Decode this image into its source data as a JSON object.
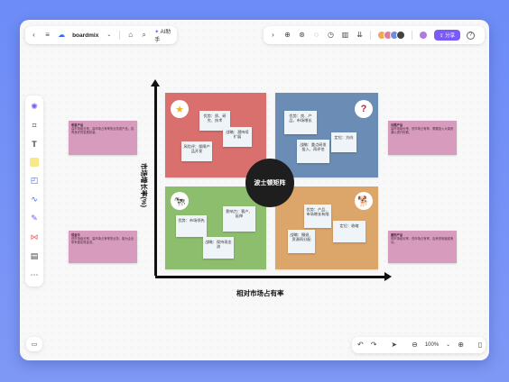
{
  "toolbar": {
    "back_icon": "chevron-left-icon",
    "menu_icon": "hamburger-icon",
    "brand": "boardmix",
    "tag_icon": "tag-icon",
    "search_icon": "search-icon",
    "ai_label": "AI助手"
  },
  "top_right": {
    "share_label": "分享",
    "help_icon": "question-icon"
  },
  "chart": {
    "center_label": "波士顿矩阵",
    "x_axis_label": "相对市场占有率",
    "y_axis_label": "市场增长率(%)"
  },
  "quadrants": {
    "star": {
      "color": "#d9706d",
      "stickies": [
        "优势：质、研究、技术",
        "风险评：保障产品开发",
        "战略：潜持续扩展"
      ]
    },
    "question": {
      "color": "#6b8db5",
      "stickies": [
        "优势：良、产品、市场增长",
        "战略：重点研发投入、再评估",
        "定位：方向"
      ]
    },
    "cow": {
      "color": "#8dbe6e",
      "stickies": [
        "优势：市场领先",
        "影响力：客户、延伸",
        "战略：保持现金流"
      ]
    },
    "dog": {
      "color": "#dca56a",
      "stickies": [
        "优势：产品、市场增长有限",
        "战略：撤退、资源再分配",
        "定位：收缩"
      ]
    }
  },
  "side_notes": {
    "top_left": {
      "title": "明星产品",
      "text": "高市场增长率、高市场占有率的业务或产品，具有良好的发展前景。"
    },
    "bottom_left": {
      "title": "现金牛",
      "text": "低市场增长率、高市场占有率的业务，能为企业带来稳定现金流。"
    },
    "top_right": {
      "title": "问题产品",
      "text": "高市场增长率、低市场占有率，需要投入大量资源以提升份额。"
    },
    "bottom_right": {
      "title": "瘦狗产品",
      "text": "低市场增长率、低市场占有率，应考虑收缩或淘汰。"
    }
  },
  "bottom_toolbar": {
    "zoom": "100%"
  }
}
